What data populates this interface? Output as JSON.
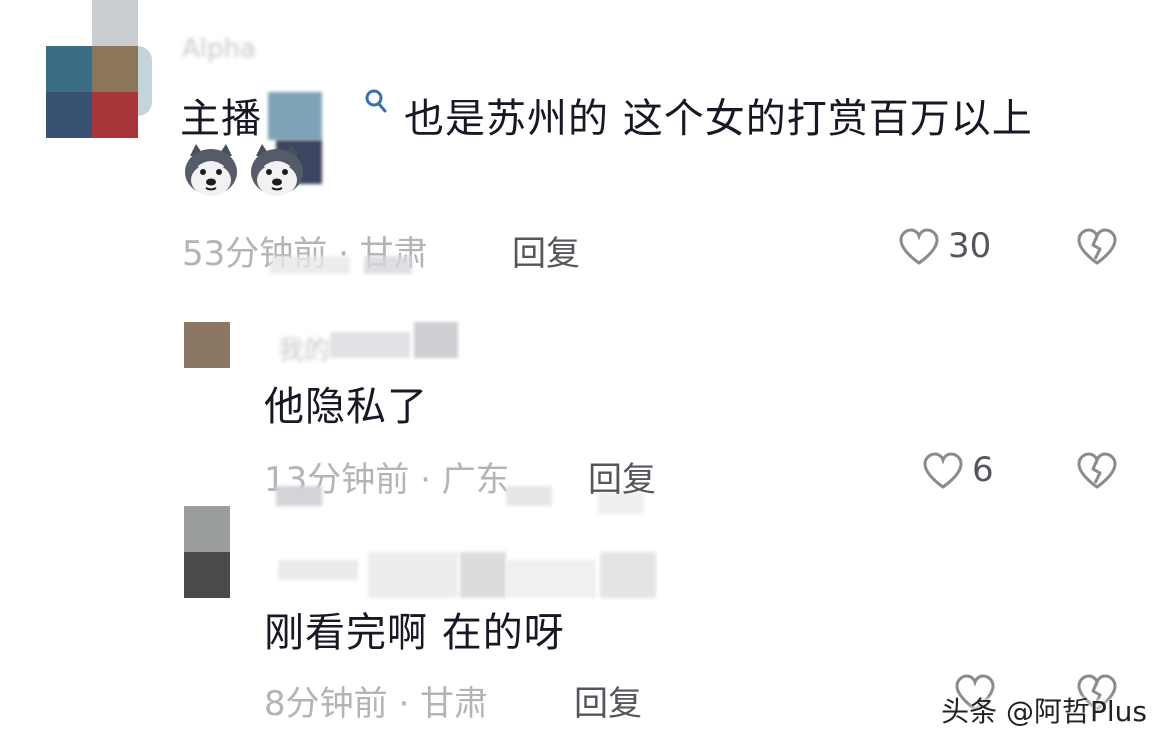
{
  "comments": [
    {
      "username": "Alpha",
      "text_prefix": "主播",
      "text_main": "也是苏州的  这个女的打赏百万以上",
      "time_location": "53分钟前 · 甘肃",
      "reply_label": "回复",
      "likes": "30"
    },
    {
      "username": "我的",
      "text_main": "他隐私了",
      "time_location": "13分钟前 · 广东",
      "reply_label": "回复",
      "likes": "6"
    },
    {
      "username": "",
      "text_main": "刚看完啊 在的呀",
      "time_location": "8分钟前 · 甘肃",
      "reply_label": "回复",
      "likes": ""
    }
  ],
  "emoji": [
    "husky-dog-emoji",
    "husky-dog-emoji"
  ],
  "watermark": "头条 @阿哲Plus",
  "colors": {
    "text": "#161823",
    "meta": "#b3b3b8",
    "icon": "#8a8a90"
  }
}
